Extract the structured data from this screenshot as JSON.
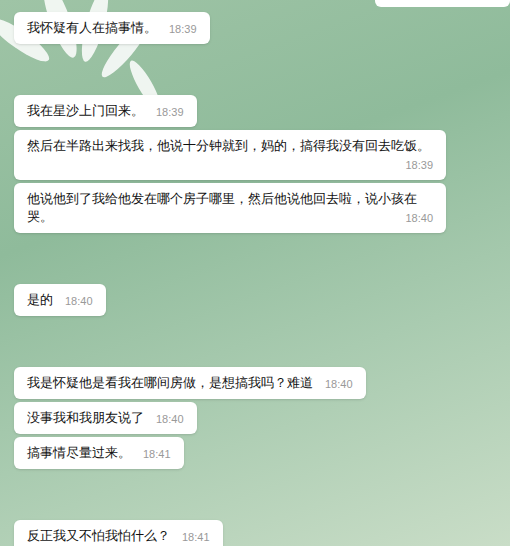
{
  "groups": [
    {
      "messages": [
        {
          "text": "我怀疑有人在搞事情。",
          "time": "18:39"
        }
      ]
    },
    {
      "messages": [
        {
          "text": "我在星沙上门回来。",
          "time": "18:39"
        },
        {
          "text": "然后在半路出来找我，他说十分钟就到，妈的，搞得我没有回去吃饭。",
          "time": "18:39"
        },
        {
          "text": "他说他到了我给他发在哪个房子哪里，然后他说他回去啦，说小孩在哭。",
          "time": "18:40"
        }
      ]
    },
    {
      "messages": [
        {
          "text": "是的",
          "time": "18:40"
        }
      ]
    },
    {
      "messages": [
        {
          "text": "我是怀疑他是看我在哪间房做，是想搞我吗？难道",
          "time": "18:40"
        },
        {
          "text": "没事我和我朋友说了",
          "time": "18:40"
        },
        {
          "text": "搞事情尽量过来。",
          "time": "18:41"
        }
      ]
    },
    {
      "messages": [
        {
          "text": "反正我又不怕我怕什么？",
          "time": "18:41"
        }
      ]
    }
  ]
}
